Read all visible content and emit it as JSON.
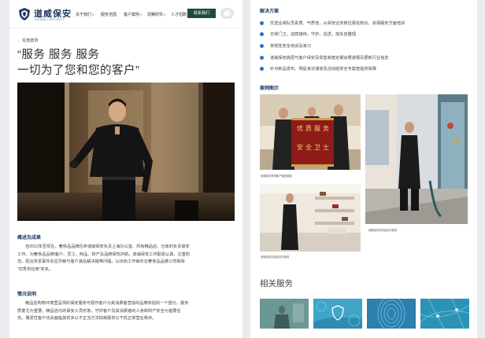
{
  "header": {
    "brand": "道威保安",
    "brand_sub": "DIANWEI SECURITY",
    "nav": [
      "关于我们",
      "服务范围",
      "客户案例",
      "洞察研究",
      "人才招聘"
    ],
    "contact_button": "联系我们"
  },
  "article": {
    "back_link": "← 经典案例",
    "headline_line1": "“服务 服务 服务",
    "headline_line2": "一切为了您和您的客户”",
    "overview_title": "概述及成果",
    "overview_lines": [
      "自2012年至现在，奢侈品品牌任命道威保安负责上海办公室、所有精品店、仓库的负责保安",
      "工作。为奢侈品品牌l客户、员工、商品、财产及品牌保驾护航。道威保安工作勤恳认真，注重防",
      "范，配合突发事件反应灵敏与客户其后解决疑难问题。以出色工作每年在奢侈品品牌公司取得",
      "“优秀供应商”奖奖。"
    ],
    "situation_title": "情况说明",
    "situation_lines": [
      "精品店购物环境里呈现的保安服务可视作客户为其消费者营造的品牌体验的一个部分。服务",
      "质量尤为重要。精品店内的保安人员形象，守护客户及其消费者的人身和财产安全为首要任",
      "务。偶发性客户也会面临其较多以不正当方法损耗服务以干扰正常营业秩序。"
    ]
  },
  "solution": {
    "title": "解决方案",
    "bullets": [
      "优选业绩队员素质、气质佳，从保安业务岗位报名权仪，双语服务方面培训",
      "日常门卫，迎宾接待，守护，巡逻，放失自整理",
      "常规性安全培训及演习",
      "道威保安高层与客户保安及零售高管定期会晤通报及更新行业信息",
      "针对新品发布、明星来访通道及活动组安全专案管提供保障"
    ]
  },
  "cases": {
    "title": "案例图示",
    "captions": [
      "道威保安获得客户赠送锦旗",
      "道威保安在精品店内值勤",
      "道威保安在精品店内值勤"
    ],
    "banner_text": [
      "优",
      "质",
      "服",
      "务",
      "安",
      "全",
      "卫",
      "士"
    ]
  },
  "related": {
    "title": "相关服务"
  },
  "colors": {
    "brand_navy": "#1f3a63",
    "accent_blue": "#2d6fc4",
    "contact_green": "#1f4b3c"
  }
}
